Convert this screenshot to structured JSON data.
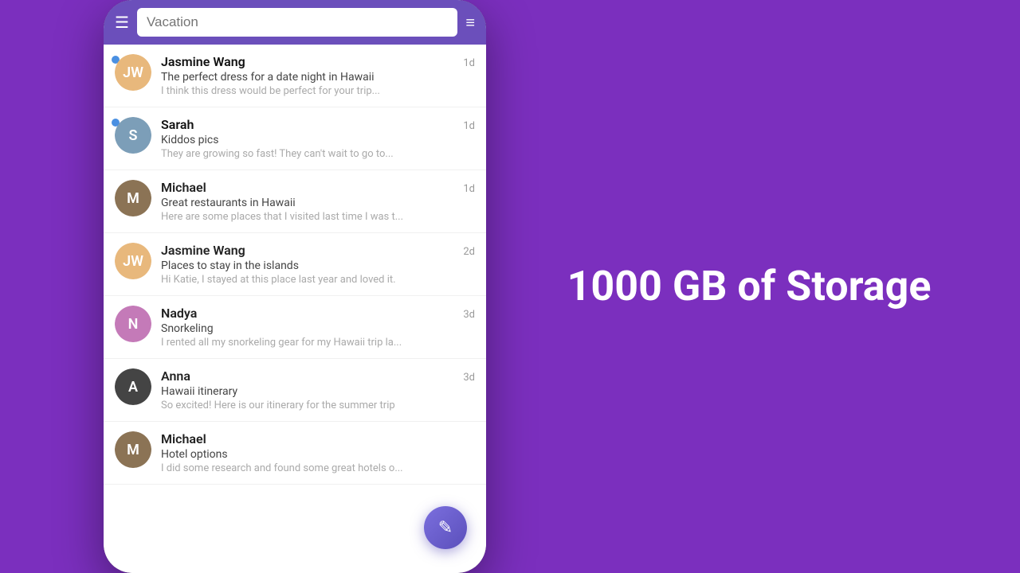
{
  "background_color": "#7B2FBE",
  "right": {
    "storage_text": "1000 GB of Storage"
  },
  "search_bar": {
    "placeholder": "Vacation",
    "menu_icon": "☰",
    "list_icon": "≡"
  },
  "messages": [
    {
      "id": 1,
      "sender": "Jasmine Wang",
      "avatar_initials": "JW",
      "avatar_color": "#E8B87C",
      "unread": true,
      "time": "1d",
      "subject": "The perfect dress for a date night in Hawaii",
      "preview": "I think this dress would be perfect for your trip..."
    },
    {
      "id": 2,
      "sender": "Sarah",
      "avatar_initials": "S",
      "avatar_color": "#7C9EB8",
      "unread": true,
      "time": "1d",
      "subject": "Kiddos pics",
      "preview": "They are growing so fast! They can't wait to go to..."
    },
    {
      "id": 3,
      "sender": "Michael",
      "avatar_initials": "M",
      "avatar_color": "#8B7355",
      "unread": false,
      "time": "1d",
      "subject": "Great restaurants in Hawaii",
      "preview": "Here are some places that I visited last time I was t..."
    },
    {
      "id": 4,
      "sender": "Jasmine Wang",
      "avatar_initials": "JW",
      "avatar_color": "#E8B87C",
      "unread": false,
      "time": "2d",
      "subject": "Places to stay in the islands",
      "preview": "Hi Katie, I stayed at this place last year and loved it."
    },
    {
      "id": 5,
      "sender": "Nadya",
      "avatar_initials": "N",
      "avatar_color": "#C47AB8",
      "unread": false,
      "time": "3d",
      "subject": "Snorkeling",
      "preview": "I rented all my snorkeling gear for my Hawaii trip la..."
    },
    {
      "id": 6,
      "sender": "Anna",
      "avatar_initials": "A",
      "avatar_color": "#444",
      "unread": false,
      "time": "3d",
      "subject": "Hawaii itinerary",
      "preview": "So excited! Here is our itinerary for the summer trip"
    },
    {
      "id": 7,
      "sender": "Michael",
      "avatar_initials": "M",
      "avatar_color": "#8B7355",
      "unread": false,
      "time": "",
      "subject": "Hotel options",
      "preview": "I did some research and found some great hotels o..."
    }
  ],
  "fab": {
    "icon": "✎"
  }
}
